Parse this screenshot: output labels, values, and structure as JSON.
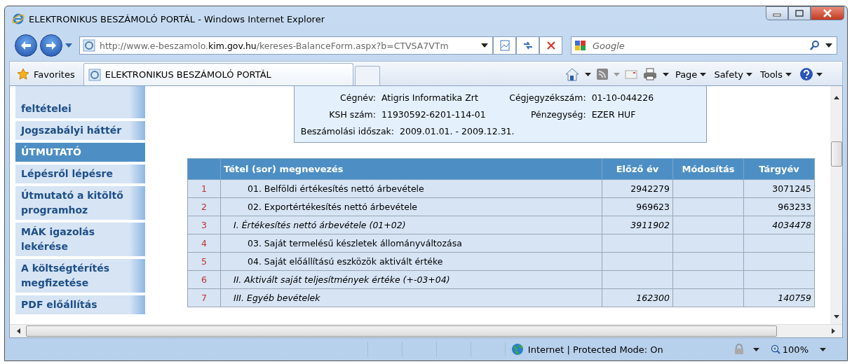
{
  "window": {
    "title": "ELEKTRONIKUS BESZÁMOLÓ PORTÁL - Windows Internet Explorer"
  },
  "address_bar": {
    "url": "http://www.e-beszamolo.**kim.gov.hu**/kereses-BalanceForm.aspx?b=CTVSA7VTm"
  },
  "search": {
    "placeholder": "Google"
  },
  "favorites": {
    "label": "Favorites"
  },
  "tabs": [
    {
      "label": "ELEKTRONIKUS BESZÁMOLÓ PORTÁL",
      "selected": true
    }
  ],
  "command_bar": {
    "menus": [
      "Page",
      "Safety",
      "Tools"
    ]
  },
  "sidebar": {
    "items": [
      {
        "label": "feltételei",
        "kind": "item"
      },
      {
        "label": "Jogszabályi háttér",
        "kind": "item"
      },
      {
        "label": "ÚTMUTATÓ",
        "kind": "heading"
      },
      {
        "label": "Lépésről lépésre",
        "kind": "item"
      },
      {
        "label": "Útmutató a kitöltő programhoz",
        "kind": "item"
      },
      {
        "label": "MÁK igazolás lekérése",
        "kind": "item"
      },
      {
        "label": "A költségtérítés megfizetése",
        "kind": "item"
      },
      {
        "label": "PDF előállítás",
        "kind": "item"
      }
    ]
  },
  "company_info": {
    "fields": [
      {
        "label": "Cégnév:",
        "value": "Atigris Informatika Zrt"
      },
      {
        "label": "Cégjegyzékszám:",
        "value": "01-10-044226"
      },
      {
        "label": "KSH szám:",
        "value": "11930592-6201-114-01"
      },
      {
        "label": "Pénzegység:",
        "value": "EZER HUF"
      },
      {
        "label": "Beszámolási időszak:",
        "value": "2009.01.01. - 2009.12.31."
      }
    ]
  },
  "table": {
    "columns": [
      "Tétel (sor) megnevezés",
      "Előző év",
      "Módosítás",
      "Tárgyév"
    ],
    "rows": [
      {
        "number": "1",
        "name": "01. Belföldi értékesítés nettó árbevétele",
        "kind": "item",
        "previous": "2942279",
        "current": "3071245"
      },
      {
        "number": "2",
        "name": "02. Exportértékesítés nettó árbevétele",
        "kind": "item",
        "previous": "969623",
        "current": "963233"
      },
      {
        "number": "3",
        "name": "I. Értékesítés nettó árbevétele (01+02)",
        "kind": "total",
        "previous": "3911902",
        "current": "4034478"
      },
      {
        "number": "4",
        "name": "03. Saját termelésű készletek állományváltozása",
        "kind": "item"
      },
      {
        "number": "5",
        "name": "04. Saját előállítású eszközök aktivált értéke",
        "kind": "item"
      },
      {
        "number": "6",
        "name": "II. Aktivált saját teljesítmények értéke (+-03+04)",
        "kind": "total"
      },
      {
        "number": "7",
        "name": "III. Egyéb bevételek",
        "kind": "total",
        "previous": "162300",
        "current": "140759"
      }
    ]
  },
  "status_bar": {
    "zone": "Internet | Protected Mode: On",
    "zoom": "100%"
  }
}
